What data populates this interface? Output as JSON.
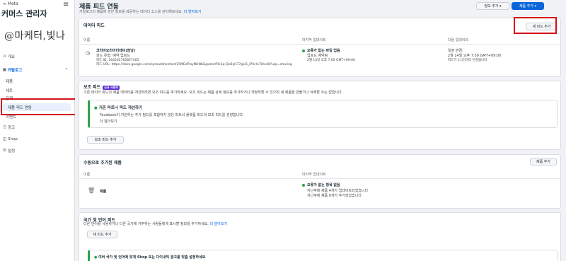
{
  "sidebar": {
    "logo": "∞ Meta",
    "title": "커머스 관리자",
    "handwriting": "@마케터,빛나",
    "items": [
      {
        "label": "개요",
        "icon": "⌂"
      },
      {
        "label": "카탈로그",
        "icon": "▣"
      },
      {
        "label": "제품"
      },
      {
        "label": "세트"
      },
      {
        "label": "문제"
      },
      {
        "label": "제품 피드 연동"
      },
      {
        "label": "이벤트"
      },
      {
        "label": "광고",
        "icon": "◷"
      },
      {
        "label": "Shop",
        "icon": "◫"
      },
      {
        "label": "설정",
        "icon": "⚙"
      }
    ]
  },
  "header": {
    "title": "제품 피드 연동",
    "subtitle": "카탈로그의 제품에 관한 정보를 제공하는 데이터 소스를 관리해보세요.",
    "subtitle_link": "더 알아보기",
    "info_btn": "정보 추가 ▾",
    "add_product_btn": "제품 추가 ▾"
  },
  "data_feeds": {
    "title": "데이터 피드",
    "new_feed_btn": "새 피드 추가",
    "col_name": "이름",
    "col_last": "마지막 업데이트",
    "col_next": "다음 업데이트",
    "feed": {
      "name": "코리아오리아더데이(잠남)",
      "type": "피드 유형: 예약 업로드",
      "id": "피드 ID: 1642627656E7405",
      "url": "피드 URL: https://docs.google.com/spreadsheets/d/15MEdPwyNUNbGgwmzYRc1q-Qo6yH77goi5_iPXcln70/edit?usp=sharing",
      "status": "오류가 없는 파일 업음",
      "status2": "업로드 예약됨",
      "last_date": "2월 14일 오후 7:00 GMT+09:00",
      "next_label": "일정 변경:",
      "next_date": "2월 14일 오후 7:59 GMT+09:00",
      "next_sub": "피드가 1시간마다 변경됩니다"
    }
  },
  "supplementary": {
    "title": "보조 피드",
    "badge": "신규 사용자",
    "desc": "기존 데이터 피드의 제품 데이터를 개선하려면 보조 피드를 추가하세요. 보조 피드는 제품 상세 정보를 추가하거나 개정하할 수 있으며 새 제품을 만들거나 삭제할 수는 없습니다.",
    "box_title": "거존 파트너 피드 개선하기",
    "box_desc": "Facebook이 지원하는 추가 필드를 포함하지 않은 파트너 플랫폼 피드의 보조 피드를 권장합니다.",
    "box_link": "더 알아보기",
    "add_btn": "보조 피드 추가"
  },
  "manual": {
    "title": "수동으로 추가된 제품",
    "add_btn": "제품 추가",
    "col_name": "이름",
    "col_last": "마지막 업데이트",
    "row_name": "제품",
    "status": "오류가 없는 항목 없음",
    "line1": "지난주에 제품 4개가 업데이트되었습니다",
    "line2": "지난주에 제품 0개가 추가되었습니다"
  },
  "country": {
    "title": "국가 및 언어 피드",
    "desc": "다른 언어를 사용하거나 다른 국가에 거주하는 사람들에게 표시할 정보를 추가하세요.",
    "link": "더 알아보기",
    "add_btn": "새 피드 추가",
    "box_text": "여러 국가 및 언어에 맞게 Shop 또는 다이내믹 광고를 맞춤 설정하세요"
  }
}
